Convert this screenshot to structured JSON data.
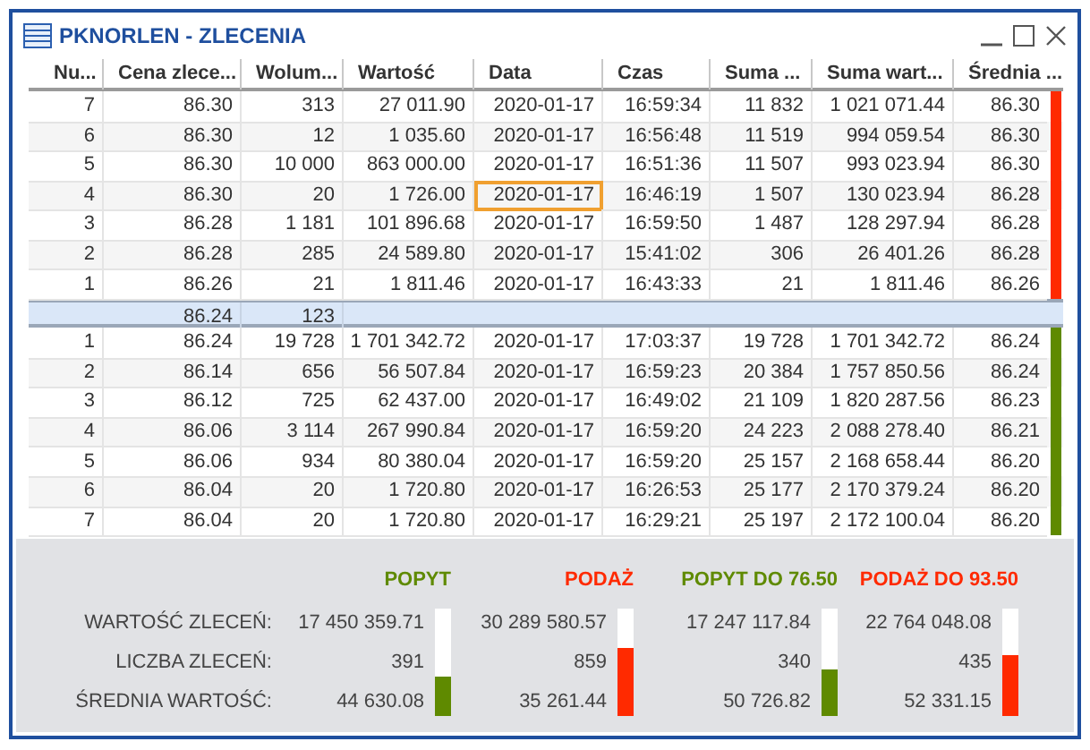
{
  "window": {
    "title": "PKNORLEN - ZLECENIA"
  },
  "columns": [
    "Nu...",
    "Cena zlece...",
    "Wolum...",
    "Wartość",
    "Data",
    "Czas",
    "Suma ...",
    "Suma wart...",
    "Średnia ..."
  ],
  "sell_orders": {
    "color": "#ff2a00",
    "rows": [
      [
        {
          "text": "7",
          "selected": false
        },
        {
          "text": "86.30",
          "selected": false
        },
        {
          "text": "313",
          "selected": false
        },
        {
          "text": "27 011.90",
          "selected": false
        },
        {
          "text": "2020-01-17",
          "selected": false
        },
        {
          "text": "16:59:34",
          "selected": false
        },
        {
          "text": "11 832",
          "selected": false
        },
        {
          "text": "1 021 071.44",
          "selected": false
        },
        {
          "text": "86.30",
          "selected": false
        }
      ],
      [
        {
          "text": "6",
          "selected": false
        },
        {
          "text": "86.30",
          "selected": false
        },
        {
          "text": "12",
          "selected": false
        },
        {
          "text": "1 035.60",
          "selected": false
        },
        {
          "text": "2020-01-17",
          "selected": false
        },
        {
          "text": "16:56:48",
          "selected": false
        },
        {
          "text": "11 519",
          "selected": false
        },
        {
          "text": "994 059.54",
          "selected": false
        },
        {
          "text": "86.30",
          "selected": false
        }
      ],
      [
        {
          "text": "5",
          "selected": false
        },
        {
          "text": "86.30",
          "selected": false
        },
        {
          "text": "10 000",
          "selected": false
        },
        {
          "text": "863 000.00",
          "selected": false
        },
        {
          "text": "2020-01-17",
          "selected": false
        },
        {
          "text": "16:51:36",
          "selected": false
        },
        {
          "text": "11 507",
          "selected": false
        },
        {
          "text": "993 023.94",
          "selected": false
        },
        {
          "text": "86.30",
          "selected": false
        }
      ],
      [
        {
          "text": "4",
          "selected": false
        },
        {
          "text": "86.30",
          "selected": false
        },
        {
          "text": "20",
          "selected": false
        },
        {
          "text": "1 726.00",
          "selected": false
        },
        {
          "text": "2020-01-17",
          "selected": true
        },
        {
          "text": "16:46:19",
          "selected": false
        },
        {
          "text": "1 507",
          "selected": false
        },
        {
          "text": "130 023.94",
          "selected": false
        },
        {
          "text": "86.28",
          "selected": false
        }
      ],
      [
        {
          "text": "3",
          "selected": false
        },
        {
          "text": "86.28",
          "selected": false
        },
        {
          "text": "1 181",
          "selected": false
        },
        {
          "text": "101 896.68",
          "selected": false
        },
        {
          "text": "2020-01-17",
          "selected": false
        },
        {
          "text": "16:59:50",
          "selected": false
        },
        {
          "text": "1 487",
          "selected": false
        },
        {
          "text": "128 297.94",
          "selected": false
        },
        {
          "text": "86.28",
          "selected": false
        }
      ],
      [
        {
          "text": "2",
          "selected": false
        },
        {
          "text": "86.28",
          "selected": false
        },
        {
          "text": "285",
          "selected": false
        },
        {
          "text": "24 589.80",
          "selected": false
        },
        {
          "text": "2020-01-17",
          "selected": false
        },
        {
          "text": "15:41:02",
          "selected": false
        },
        {
          "text": "306",
          "selected": false
        },
        {
          "text": "26 401.26",
          "selected": false
        },
        {
          "text": "86.28",
          "selected": false
        }
      ],
      [
        {
          "text": "1",
          "selected": false
        },
        {
          "text": "86.26",
          "selected": false
        },
        {
          "text": "21",
          "selected": false
        },
        {
          "text": "1 811.46",
          "selected": false
        },
        {
          "text": "2020-01-17",
          "selected": false
        },
        {
          "text": "16:43:33",
          "selected": false
        },
        {
          "text": "21",
          "selected": false
        },
        {
          "text": "1 811.46",
          "selected": false
        },
        {
          "text": "86.26",
          "selected": false
        }
      ]
    ]
  },
  "spread_row": {
    "price": "86.24",
    "volume": "123"
  },
  "buy_orders": {
    "color": "#5f8a00",
    "rows": [
      [
        {
          "text": "1",
          "selected": false
        },
        {
          "text": "86.24",
          "selected": false
        },
        {
          "text": "19 728",
          "selected": false
        },
        {
          "text": "1 701 342.72",
          "selected": false
        },
        {
          "text": "2020-01-17",
          "selected": false
        },
        {
          "text": "17:03:37",
          "selected": false
        },
        {
          "text": "19 728",
          "selected": false
        },
        {
          "text": "1 701 342.72",
          "selected": false
        },
        {
          "text": "86.24",
          "selected": false
        }
      ],
      [
        {
          "text": "2",
          "selected": false
        },
        {
          "text": "86.14",
          "selected": false
        },
        {
          "text": "656",
          "selected": false
        },
        {
          "text": "56 507.84",
          "selected": false
        },
        {
          "text": "2020-01-17",
          "selected": false
        },
        {
          "text": "16:59:23",
          "selected": false
        },
        {
          "text": "20 384",
          "selected": false
        },
        {
          "text": "1 757 850.56",
          "selected": false
        },
        {
          "text": "86.24",
          "selected": false
        }
      ],
      [
        {
          "text": "3",
          "selected": false
        },
        {
          "text": "86.12",
          "selected": false
        },
        {
          "text": "725",
          "selected": false
        },
        {
          "text": "62 437.00",
          "selected": false
        },
        {
          "text": "2020-01-17",
          "selected": false
        },
        {
          "text": "16:49:02",
          "selected": false
        },
        {
          "text": "21 109",
          "selected": false
        },
        {
          "text": "1 820 287.56",
          "selected": false
        },
        {
          "text": "86.23",
          "selected": false
        }
      ],
      [
        {
          "text": "4",
          "selected": false
        },
        {
          "text": "86.06",
          "selected": false
        },
        {
          "text": "3 114",
          "selected": false
        },
        {
          "text": "267 990.84",
          "selected": false
        },
        {
          "text": "2020-01-17",
          "selected": false
        },
        {
          "text": "16:59:20",
          "selected": false
        },
        {
          "text": "24 223",
          "selected": false
        },
        {
          "text": "2 088 278.40",
          "selected": false
        },
        {
          "text": "86.21",
          "selected": false
        }
      ],
      [
        {
          "text": "5",
          "selected": false
        },
        {
          "text": "86.06",
          "selected": false
        },
        {
          "text": "934",
          "selected": false
        },
        {
          "text": "80 380.04",
          "selected": false
        },
        {
          "text": "2020-01-17",
          "selected": false
        },
        {
          "text": "16:59:20",
          "selected": false
        },
        {
          "text": "25 157",
          "selected": false
        },
        {
          "text": "2 168 658.44",
          "selected": false
        },
        {
          "text": "86.20",
          "selected": false
        }
      ],
      [
        {
          "text": "6",
          "selected": false
        },
        {
          "text": "86.04",
          "selected": false
        },
        {
          "text": "20",
          "selected": false
        },
        {
          "text": "1 720.80",
          "selected": false
        },
        {
          "text": "2020-01-17",
          "selected": false
        },
        {
          "text": "16:26:53",
          "selected": false
        },
        {
          "text": "25 177",
          "selected": false
        },
        {
          "text": "2 170 379.24",
          "selected": false
        },
        {
          "text": "86.20",
          "selected": false
        }
      ],
      [
        {
          "text": "7",
          "selected": false
        },
        {
          "text": "86.04",
          "selected": false
        },
        {
          "text": "20",
          "selected": false
        },
        {
          "text": "1 720.80",
          "selected": false
        },
        {
          "text": "2020-01-17",
          "selected": false
        },
        {
          "text": "16:29:21",
          "selected": false
        },
        {
          "text": "25 197",
          "selected": false
        },
        {
          "text": "2 172 100.04",
          "selected": false
        },
        {
          "text": "86.20",
          "selected": false
        }
      ]
    ]
  },
  "summary": {
    "row_labels": [
      "WARTOŚĆ ZLECEŃ:",
      "LICZBA ZLECEŃ:",
      "ŚREDNIA WARTOŚĆ:"
    ],
    "groups": [
      {
        "title": "POPYT",
        "color": "#5f8a00",
        "values": [
          "17 450 359.71",
          "391",
          "44 630.08"
        ],
        "level": 0.37
      },
      {
        "title": "PODAŻ",
        "color": "#ff2a00",
        "values": [
          "30 289 580.57",
          "859",
          "35 261.44"
        ],
        "level": 0.63
      },
      {
        "title": "POPYT DO 76.50",
        "color": "#5f8a00",
        "values": [
          "17 247 117.84",
          "340",
          "50 726.82"
        ],
        "level": 0.44
      },
      {
        "title": "PODAŻ DO 93.50",
        "color": "#ff2a00",
        "values": [
          "22 764 048.08",
          "435",
          "52 331.15"
        ],
        "level": 0.57
      }
    ]
  }
}
